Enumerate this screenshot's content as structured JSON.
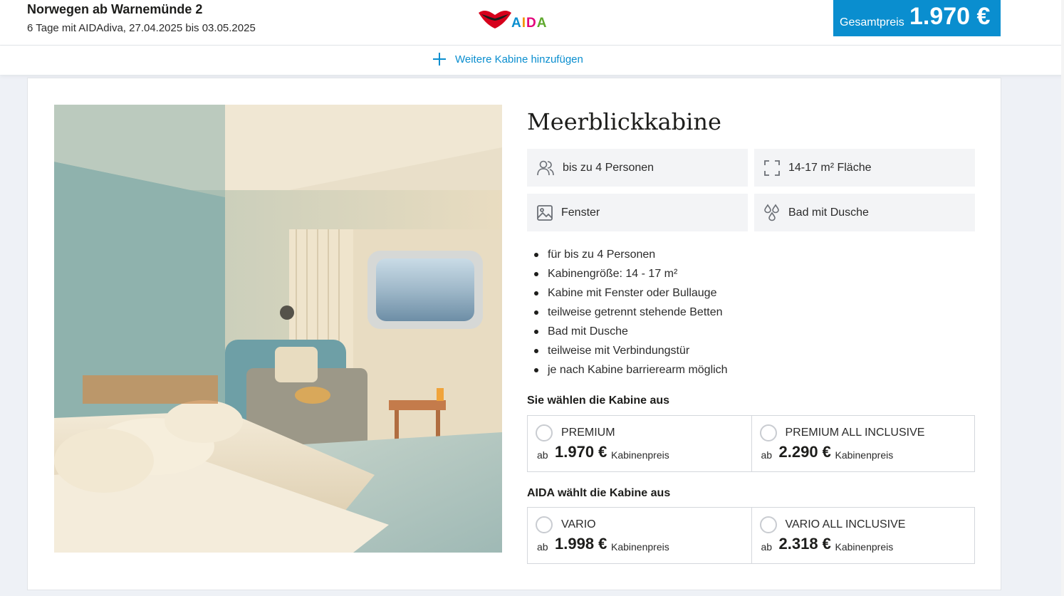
{
  "header": {
    "title": "Norwegen ab Warnemünde 2",
    "subtitle": "6 Tage mit AIDAdiva, 27.04.2025 bis 03.05.2025",
    "logo_text": "AIDA",
    "total_label": "Gesamtpreis",
    "total_price": "1.970 €"
  },
  "add_cabin": {
    "label": "Weitere Kabine hinzufügen",
    "icon": "plus-icon"
  },
  "cabin": {
    "title": "Meerblickkabine",
    "image": "cabin-photo",
    "features": [
      {
        "icon": "people-icon",
        "label": "bis zu 4 Personen"
      },
      {
        "icon": "area-icon",
        "label": "14-17 m² Fläche"
      },
      {
        "icon": "window-icon",
        "label": "Fenster"
      },
      {
        "icon": "shower-icon",
        "label": "Bad mit Dusche"
      }
    ],
    "bullets": [
      "für bis zu 4 Personen",
      "Kabinengröße: 14 - 17 m²",
      "Kabine mit Fenster oder Bullauge",
      "teilweise getrennt stehende Betten",
      "Bad mit Dusche",
      "teilweise mit Verbindungstür",
      "je nach Kabine barrierearm möglich"
    ]
  },
  "groups": [
    {
      "title": "Sie wählen die Kabine aus",
      "options": [
        {
          "name": "PREMIUM",
          "ab": "ab",
          "price": "1.970 €",
          "suffix": "Kabinenpreis"
        },
        {
          "name": "PREMIUM ALL INCLUSIVE",
          "ab": "ab",
          "price": "2.290 €",
          "suffix": "Kabinenpreis"
        }
      ]
    },
    {
      "title": "AIDA wählt die Kabine aus",
      "options": [
        {
          "name": "VARIO",
          "ab": "ab",
          "price": "1.998 €",
          "suffix": "Kabinenpreis"
        },
        {
          "name": "VARIO ALL INCLUSIVE",
          "ab": "ab",
          "price": "2.318 €",
          "suffix": "Kabinenpreis"
        }
      ]
    }
  ],
  "colors": {
    "accent": "#0a8ecf",
    "logo_red": "#d6001c",
    "feature_bg": "#f3f4f6"
  }
}
